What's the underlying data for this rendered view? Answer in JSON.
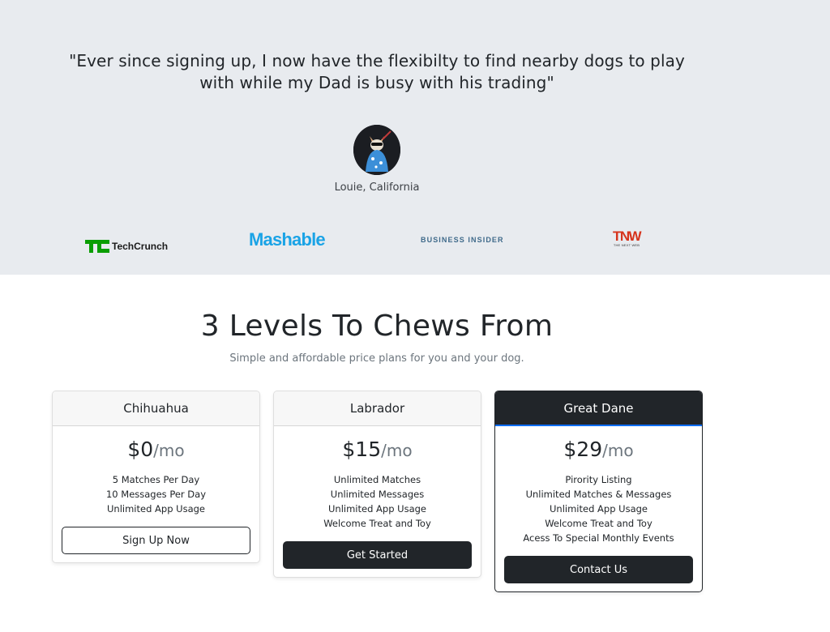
{
  "testimonial": {
    "quote": "\"Ever since signing up, I now have the flexibilty to find nearby dogs to play with while my Dad is busy with his trading\"",
    "author": "Louie, California"
  },
  "press": {
    "techcrunch": "TechCrunch",
    "mashable": "Mashable",
    "business_insider": "BUSINESS INSIDER",
    "tnw": "TNW",
    "tnw_sub": "THE NEXT WEB"
  },
  "pricing": {
    "title": "3 Levels To Chews From",
    "subtitle": "Simple and affordable price plans for you and your dog.",
    "period": "/mo",
    "plans": [
      {
        "name": "Chihuahua",
        "price": "$0",
        "features": [
          "5 Matches Per Day",
          "10 Messages Per Day",
          "Unlimited App Usage"
        ],
        "button": "Sign Up Now"
      },
      {
        "name": "Labrador",
        "price": "$15",
        "features": [
          "Unlimited Matches",
          "Unlimited Messages",
          "Unlimited App Usage",
          "Welcome Treat and Toy"
        ],
        "button": "Get Started"
      },
      {
        "name": "Great Dane",
        "price": "$29",
        "features": [
          "Pirority Listing",
          "Unlimited Matches & Messages",
          "Unlimited App Usage",
          "Welcome Treat and Toy",
          "Acess To Special Monthly Events"
        ],
        "button": "Contact Us"
      }
    ]
  },
  "colors": {
    "testimonial_bg": "#e8ebef",
    "dark": "#212529",
    "mashable_blue": "#1aa3e6",
    "techcrunch_green": "#0a9e01",
    "tnw_red": "#d6341d",
    "accent_border": "#0d6efd"
  }
}
